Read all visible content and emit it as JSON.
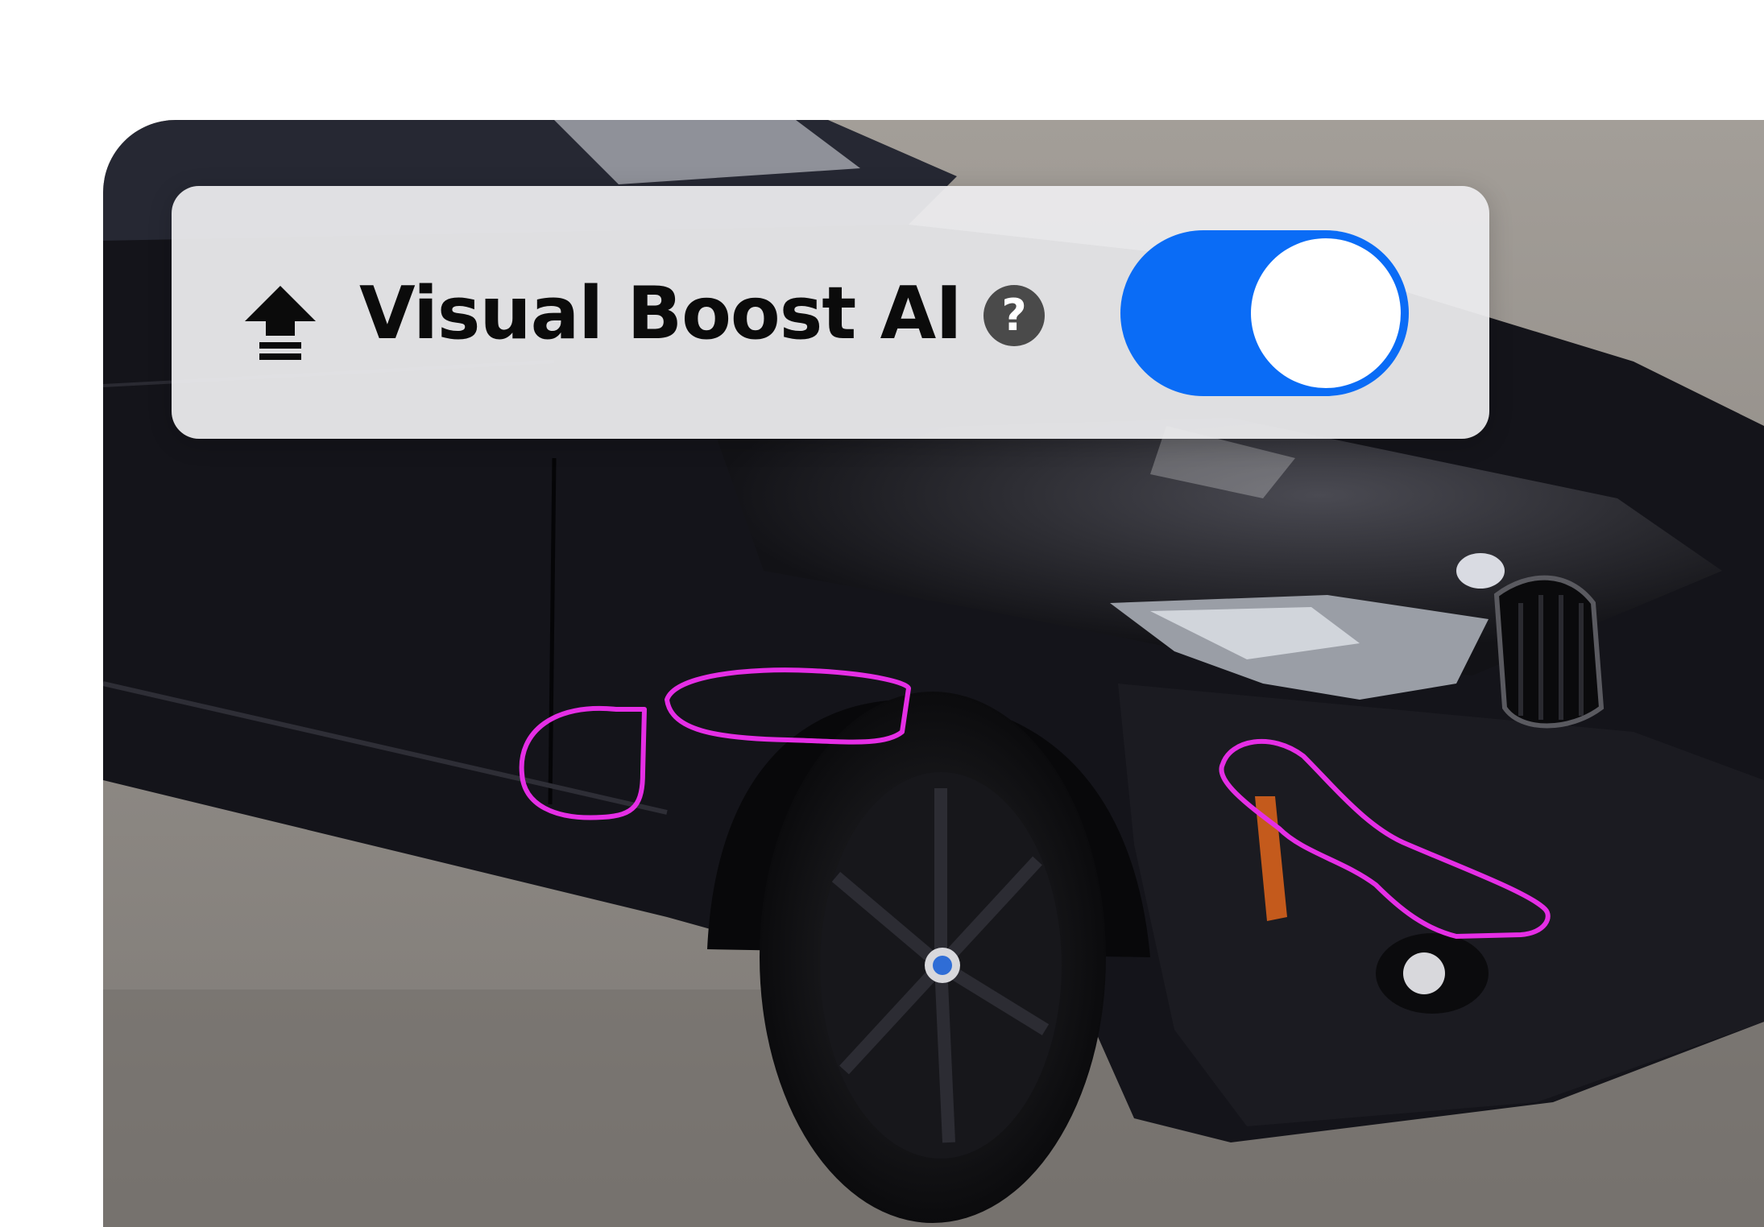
{
  "boost_panel": {
    "label": "Visual Boost AI",
    "help_glyph": "?",
    "toggle": {
      "state": "on",
      "color": "#0a6cf6"
    },
    "icons": [
      "boost-arrow-icon",
      "help-circle-icon"
    ]
  },
  "photo": {
    "subject": "car-photo",
    "annotation_color": "#e52ee5"
  }
}
